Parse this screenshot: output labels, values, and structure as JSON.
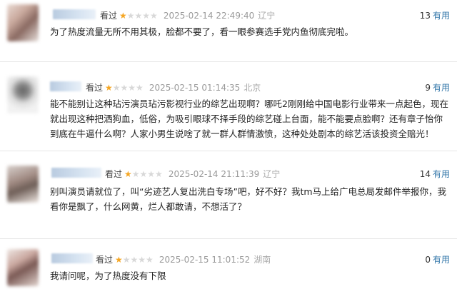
{
  "reviews": [
    {
      "label": "看过",
      "stars": 1,
      "date": "2025-02-14 22:49:40",
      "location": "辽宁",
      "useful_count": "13",
      "useful_label": "有用",
      "content": "为了热度流量无所不用其极，脸都不要了，看一眼参赛选手党内鱼彻底完啦。"
    },
    {
      "label": "看过",
      "stars": 1,
      "date": "2025-02-15 01:14:35",
      "location": "北京",
      "useful_count": "9",
      "useful_label": "有用",
      "content": "能不能别让这种玷污演员玷污影视行业的综艺出现啊？哪吒2刚刚给中国电影行业带来一点起色，现在就出现这种把洒狗血，低俗，为吸引眼球不择手段的综艺碰上台面，能不能要点脸啊？还有章子怡你到底在牛逼什么啊？人家小男生说啥了就一群人群情激愤，这种处处剧本的综艺活该投资全赔光！"
    },
    {
      "label": "看过",
      "stars": 1,
      "date": "2025-02-14 21:11:39",
      "location": "辽宁",
      "useful_count": "14",
      "useful_label": "有用",
      "content": "别叫演员请就位了，叫“劣迹艺人复出洗白专场”吧，好不好？我tm马上给广电总局发邮件举报你，我看你是飘了，什么网黄，烂人都敢请，不想活了？"
    },
    {
      "label": "看过",
      "stars": 1,
      "date": "2025-02-15 11:01:52",
      "location": "湖南",
      "useful_count": "0",
      "useful_label": "有用",
      "content": "我请问呢，为了热度没有下限"
    }
  ],
  "colors": {
    "star_on": "#f5a623",
    "star_off": "#d8d8d8",
    "useful_link": "#3377aa"
  }
}
